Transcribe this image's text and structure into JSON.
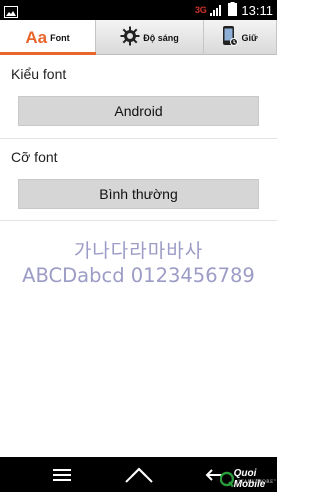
{
  "status_bar": {
    "network_label": "3G",
    "time": "13:11",
    "carrier_badge_color": "#d0312d"
  },
  "tabs": [
    {
      "icon": "aa-font-icon",
      "icon_text": "Aa",
      "label": "Font",
      "active": true
    },
    {
      "icon": "gear-brightness-icon",
      "label": "Độ sáng",
      "active": false
    },
    {
      "icon": "phone-keep-icon",
      "label": "Giữ",
      "active": false
    }
  ],
  "font_type": {
    "title": "Kiểu font",
    "value": "Android"
  },
  "font_size": {
    "title": "Cỡ font",
    "value": "Bình thường"
  },
  "preview": {
    "korean": "가나다라마바사",
    "latin": "ABCDabcd 0123456789"
  },
  "watermark": {
    "brand": "Quoi Mobile",
    "slogan": "\"TALK MORE\""
  },
  "colors": {
    "accent": "#e8652b",
    "preview_text": "#9c9cc6"
  }
}
